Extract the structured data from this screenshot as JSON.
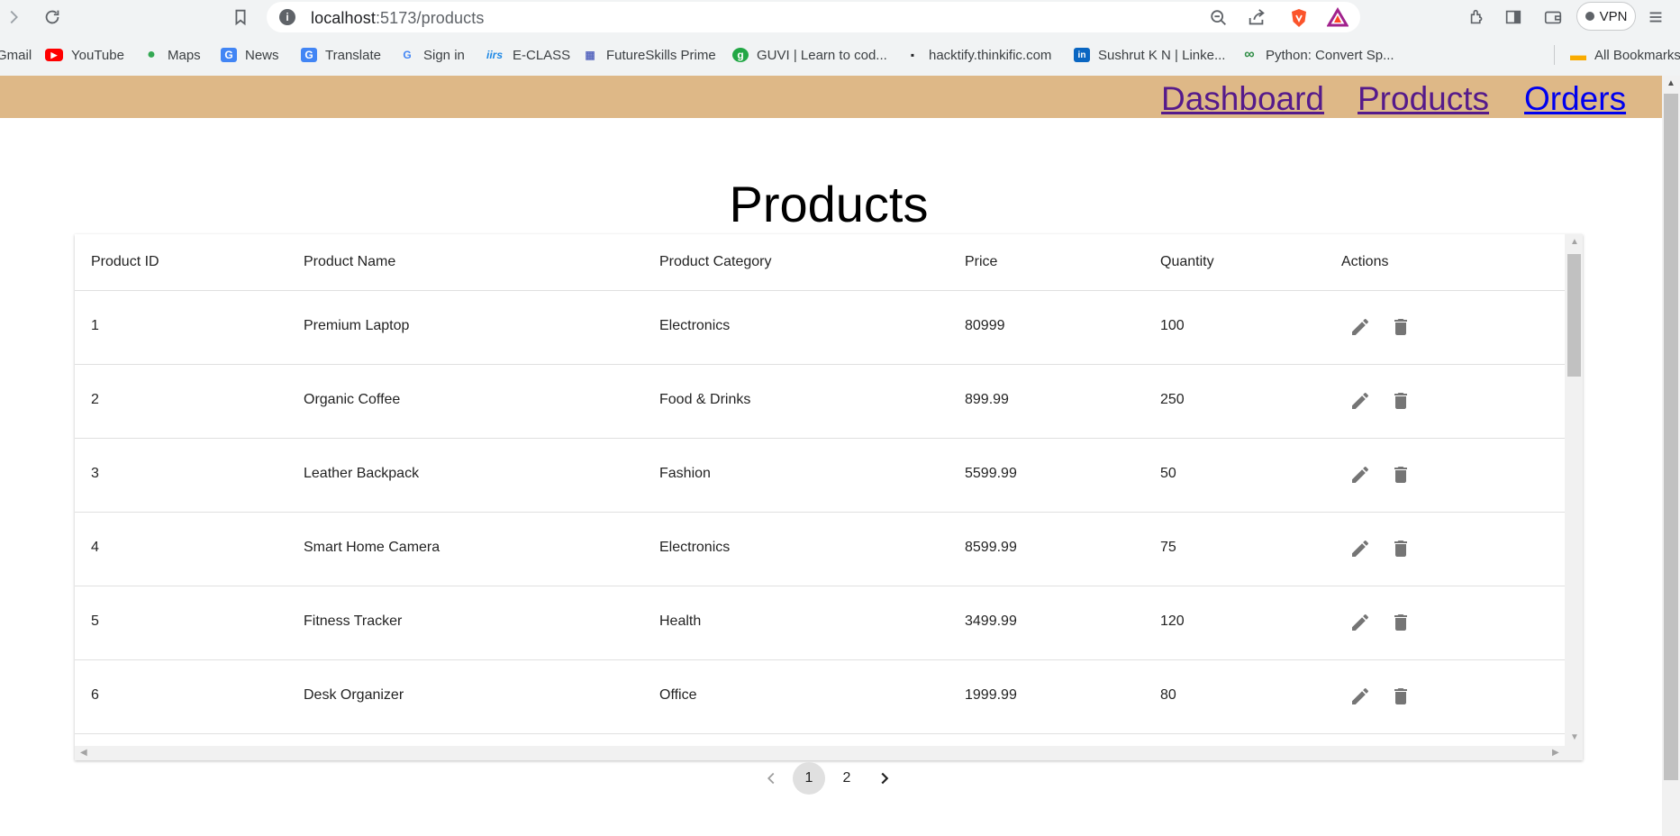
{
  "browser": {
    "url_host": "localhost",
    "url_path": ":5173/products",
    "vpn_label": "VPN",
    "icons": [
      "forward-icon",
      "reload-icon",
      "bookmark-star-icon",
      "site-info-icon",
      "zoom-icon",
      "share-icon",
      "brave-shields-icon",
      "brave-rewards-icon",
      "extensions-icon",
      "sidebar-icon",
      "wallet-icon",
      "menu-icon"
    ]
  },
  "bookmarks": [
    {
      "label": "Gmail",
      "color": "#ea4335",
      "glyph": ""
    },
    {
      "label": "YouTube",
      "color": "#ff0000",
      "glyph": "▶"
    },
    {
      "label": "Maps",
      "color": "#34a853",
      "glyph": "●"
    },
    {
      "label": "News",
      "color": "#4285f4",
      "glyph": "G"
    },
    {
      "label": "Translate",
      "color": "#4285f4",
      "glyph": "G"
    },
    {
      "label": "Sign in",
      "color": "#4285f4",
      "glyph": "G"
    },
    {
      "label": "E-CLASS",
      "color": "#1e88e5",
      "glyph": "iirs"
    },
    {
      "label": "FutureSkills Prime",
      "color": "#5c6bc0",
      "glyph": "▦"
    },
    {
      "label": "GUVI | Learn to cod...",
      "color": "#22a745",
      "glyph": "g"
    },
    {
      "label": "hacktify.thinkific.com",
      "color": "#202124",
      "glyph": "▪"
    },
    {
      "label": "Sushrut K N | Linke...",
      "color": "#0a66c2",
      "glyph": "in"
    },
    {
      "label": "Python: Convert Sp...",
      "color": "#2f8d46",
      "glyph": "∞"
    },
    {
      "label": "All Bookmarks",
      "color": "#f9ab00",
      "glyph": "▬"
    }
  ],
  "nav": {
    "dashboard": "Dashboard",
    "products": "Products",
    "orders": "Orders",
    "bg_color": "#deb887",
    "visited_color": "#551a8b",
    "link_color": "#0000ee"
  },
  "page_title": "Products",
  "table": {
    "headers": [
      "Product ID",
      "Product Name",
      "Product Category",
      "Price",
      "Quantity",
      "Actions"
    ],
    "rows": [
      {
        "id": "1",
        "name": "Premium Laptop",
        "category": "Electronics",
        "price": "80999",
        "quantity": "100"
      },
      {
        "id": "2",
        "name": "Organic Coffee",
        "category": "Food & Drinks",
        "price": "899.99",
        "quantity": "250"
      },
      {
        "id": "3",
        "name": "Leather Backpack",
        "category": "Fashion",
        "price": "5599.99",
        "quantity": "50"
      },
      {
        "id": "4",
        "name": "Smart Home Camera",
        "category": "Electronics",
        "price": "8599.99",
        "quantity": "75"
      },
      {
        "id": "5",
        "name": "Fitness Tracker",
        "category": "Health",
        "price": "3499.99",
        "quantity": "120"
      },
      {
        "id": "6",
        "name": "Desk Organizer",
        "category": "Office",
        "price": "1999.99",
        "quantity": "80"
      }
    ],
    "action_icons": [
      "edit-icon",
      "delete-icon"
    ]
  },
  "pagination": {
    "pages": [
      "1",
      "2"
    ],
    "current": "1"
  }
}
